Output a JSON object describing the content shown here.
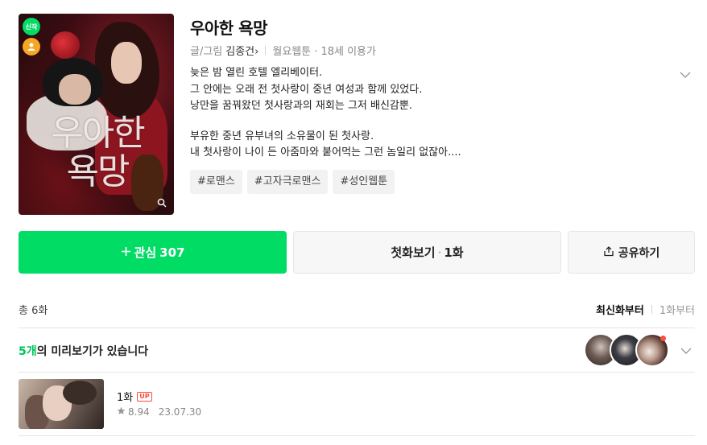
{
  "series": {
    "cover_title": "우아한 욕망",
    "badge_new": "신작",
    "title": "우아한 욕망",
    "author_prefix": "글/그림",
    "author": "김종건",
    "author_arrow": "›",
    "day": "월요웹툰",
    "age": "· 18세 이용가",
    "description": [
      "늦은 밤 열린 호텔 엘리베이터.",
      "그 안에는 오래 전 첫사랑이 중년 여성과 함께 있었다.",
      "낭만을 꿈꿔왔던 첫사랑과의 재회는 그저 배신감뿐.",
      "",
      "부유한 중년 유부녀의 소유물이 된 첫사랑.",
      "내 첫사랑이 나이 든 아줌마와 붙어먹는 그런 놈일리 없잖아...."
    ],
    "tags": [
      "#로맨스",
      "#고자극로맨스",
      "#성인웹툰"
    ]
  },
  "actions": {
    "favorite_label": "관심",
    "favorite_count": "307",
    "first_label": "첫화보기",
    "first_ep": "1화",
    "share_label": "공유하기"
  },
  "episodes": {
    "total": "총 6화",
    "sort_latest": "최신화부터",
    "sort_first": "1화부터",
    "preview_count": "5개",
    "preview_text": "의 미리보기가 있습니다",
    "list": [
      {
        "title": "1화",
        "badge": "UP",
        "rating": "8.94",
        "date": "23.07.30"
      }
    ]
  },
  "colors": {
    "accent": "#00dc64",
    "up_badge": "#ff4a3d"
  },
  "icons": {
    "new_badge": "new-badge",
    "person": "person-icon",
    "zoom": "magnifier-icon",
    "expand": "chevron-down-icon",
    "share": "share-icon",
    "plus": "plus-icon",
    "star": "star-icon"
  }
}
